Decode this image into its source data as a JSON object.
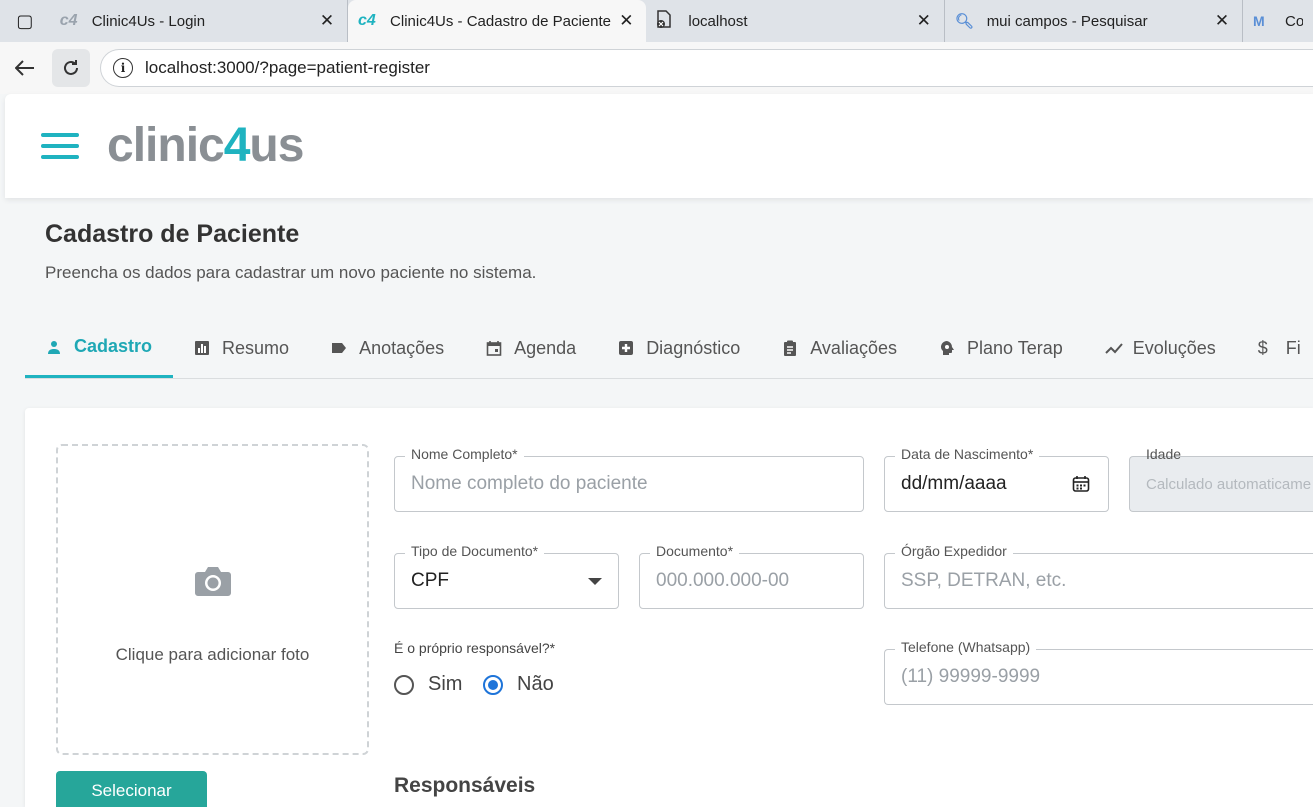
{
  "browser": {
    "tabs": [
      {
        "favicon": "c4",
        "title": "Clinic4Us - Login",
        "active": false
      },
      {
        "favicon": "c4",
        "title": "Clinic4Us - Cadastro de Paciente",
        "active": true
      },
      {
        "favicon": "file-blocked-icon",
        "title": "localhost",
        "active": false
      },
      {
        "favicon": "search-icon",
        "title": "mui campos - Pesquisar",
        "active": false
      },
      {
        "favicon": "mui-icon",
        "title": "Co",
        "active": false
      }
    ],
    "url": "localhost:3000/?page=patient-register"
  },
  "header": {
    "logo_prefix": "clinic",
    "logo_four": "4",
    "logo_suffix": "us"
  },
  "page": {
    "title": "Cadastro de Paciente",
    "subtitle": "Preencha os dados para cadastrar um novo paciente no sistema."
  },
  "tabs": [
    {
      "label": "Cadastro",
      "icon": "person-icon",
      "active": true
    },
    {
      "label": "Resumo",
      "icon": "chart-icon"
    },
    {
      "label": "Anotações",
      "icon": "label-icon"
    },
    {
      "label": "Agenda",
      "icon": "calendar-icon"
    },
    {
      "label": "Diagnóstico",
      "icon": "medical-plus-icon"
    },
    {
      "label": "Avaliações",
      "icon": "clipboard-icon"
    },
    {
      "label": "Plano Terap",
      "icon": "psychology-icon"
    },
    {
      "label": "Evoluções",
      "icon": "trending-icon"
    },
    {
      "label": "Fi",
      "icon": "dollar-icon"
    }
  ],
  "photo": {
    "label": "Clique para adicionar foto",
    "button": "Selecionar"
  },
  "form": {
    "nome": {
      "label": "Nome Completo*",
      "placeholder": "Nome completo do paciente"
    },
    "nascimento": {
      "label": "Data de Nascimento*",
      "value": "dd/mm/aaaa"
    },
    "idade": {
      "label": "Idade",
      "placeholder": "Calculado automaticame"
    },
    "tipo_doc": {
      "label": "Tipo de Documento*",
      "value": "CPF"
    },
    "documento": {
      "label": "Documento*",
      "placeholder": "000.000.000-00"
    },
    "orgao": {
      "label": "Órgão Expedidor",
      "placeholder": "SSP, DETRAN, etc."
    },
    "responsavel": {
      "label": "É o próprio responsável?*",
      "opt_yes": "Sim",
      "opt_no": "Não",
      "selected": "Não"
    },
    "telefone": {
      "label": "Telefone (Whatsapp)",
      "placeholder": "(11) 99999-9999"
    }
  },
  "section": {
    "responsaveis": "Responsáveis"
  }
}
